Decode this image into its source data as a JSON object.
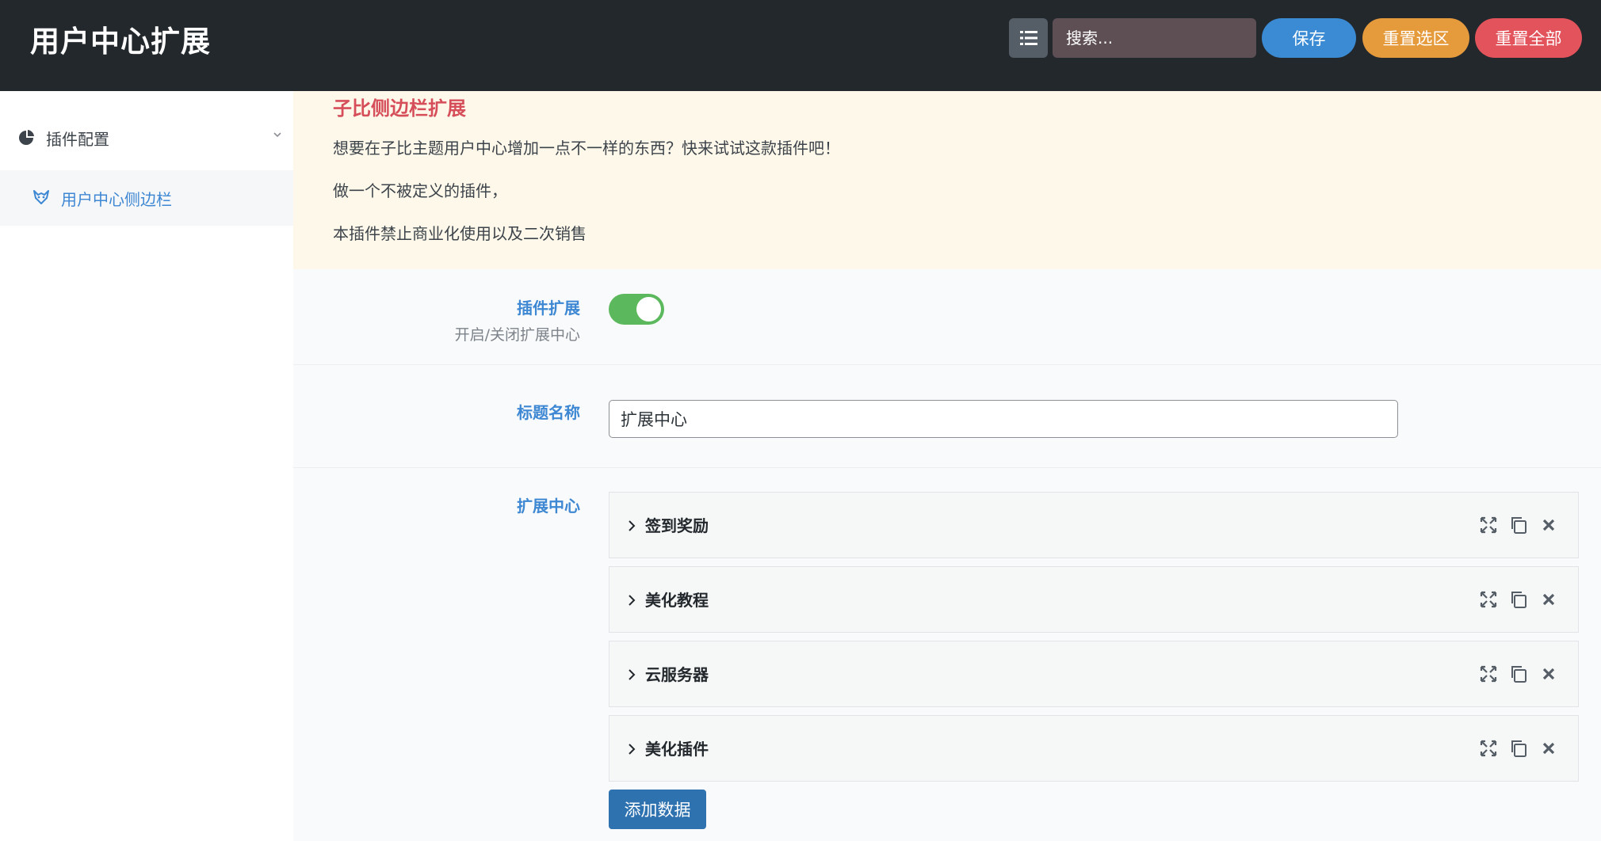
{
  "header": {
    "title": "用户中心扩展",
    "search_placeholder": "搜索...",
    "save_label": "保存",
    "reset_section_label": "重置选区",
    "reset_all_label": "重置全部"
  },
  "sidebar": {
    "parent_label": "插件配置",
    "child_label": "用户中心侧边栏"
  },
  "notice": {
    "title": "子比侧边栏扩展",
    "lines": [
      "想要在子比主题用户中心增加一点不一样的东西？快来试试这款插件吧！",
      "做一个不被定义的插件，",
      "本插件禁止商业化使用以及二次销售"
    ]
  },
  "fields": {
    "plugin_ext": {
      "label": "插件扩展",
      "sub": "开启/关闭扩展中心",
      "enabled": true
    },
    "title_name": {
      "label": "标题名称",
      "value": "扩展中心"
    },
    "ext_center": {
      "label": "扩展中心",
      "groups": [
        "签到奖励",
        "美化教程",
        "云服务器",
        "美化插件"
      ],
      "add_label": "添加数据"
    }
  },
  "colors": {
    "header_bg": "#23282d",
    "accent_blue": "#3d87d3",
    "save": "#3a8bd4",
    "reset_section": "#e59a3c",
    "reset_all": "#e3535b",
    "toggle_on": "#5bb85c",
    "notice_title": "#d54e5a"
  }
}
